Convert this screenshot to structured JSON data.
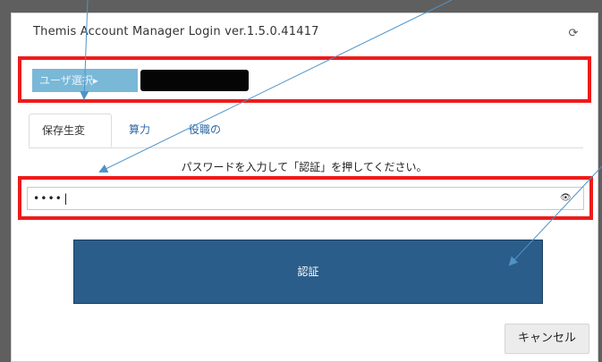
{
  "window": {
    "title": "Themis Account Manager Login   ver.1.5.0.41417",
    "refresh_icon": "refresh-icon"
  },
  "user": {
    "select_label": "ユーザ選択▸",
    "name_redacted": ""
  },
  "tabs": [
    {
      "label": "保存生変",
      "active": true
    },
    {
      "label": "算力",
      "active": false
    },
    {
      "label": "役職の",
      "active": false
    }
  ],
  "instruction": "パスワードを入力して「認証」を押してください。",
  "password": {
    "value": "••••|",
    "eye_icon": "eye-icon"
  },
  "buttons": {
    "authenticate": "認証",
    "cancel": "キャンセル"
  },
  "colors": {
    "highlight": "#ee1b1b",
    "primary_button": "#2b5d8a",
    "user_select": "#7ab8d8",
    "arrow": "#4f93c6"
  }
}
